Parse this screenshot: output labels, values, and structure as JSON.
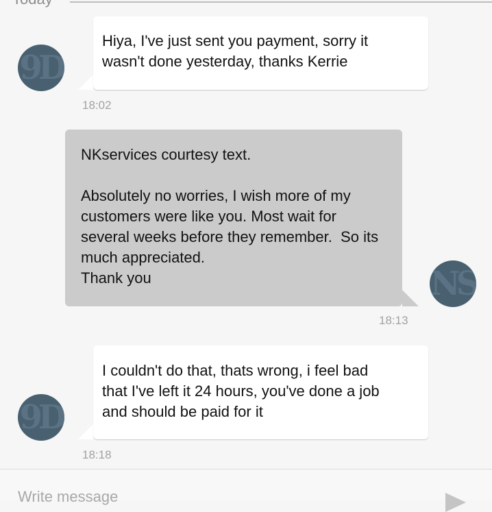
{
  "date_divider": {
    "label": "Today"
  },
  "messages": [
    {
      "direction": "incoming",
      "avatar_glyph": "9D",
      "text": "Hiya, I've just sent you payment, sorry it\nwasn't done yesterday, thanks Kerrie",
      "time": "18:02"
    },
    {
      "direction": "outgoing",
      "avatar_glyph": "NS",
      "text": "NKservices courtesy text.\n\nAbsolutely no worries, I wish more of my\ncustomers were like you. Most wait for\nseveral weeks before they remember.  So its\nmuch appreciated.\nThank you",
      "time": "18:13"
    },
    {
      "direction": "incoming",
      "avatar_glyph": "9D",
      "text": "I couldn't do that, thats wrong, i feel bad\nthat I've left it 24 hours, you've done a job\nand should be paid for it",
      "time": "18:18"
    }
  ],
  "composer": {
    "placeholder": "Write message"
  },
  "colors": {
    "background": "#f6f6f6",
    "incoming_bubble": "#ffffff",
    "outgoing_bubble": "#cbcbcb",
    "avatar": "#48606f",
    "timestamp": "#a2a2a2"
  },
  "icons": {
    "send": "send-icon"
  }
}
